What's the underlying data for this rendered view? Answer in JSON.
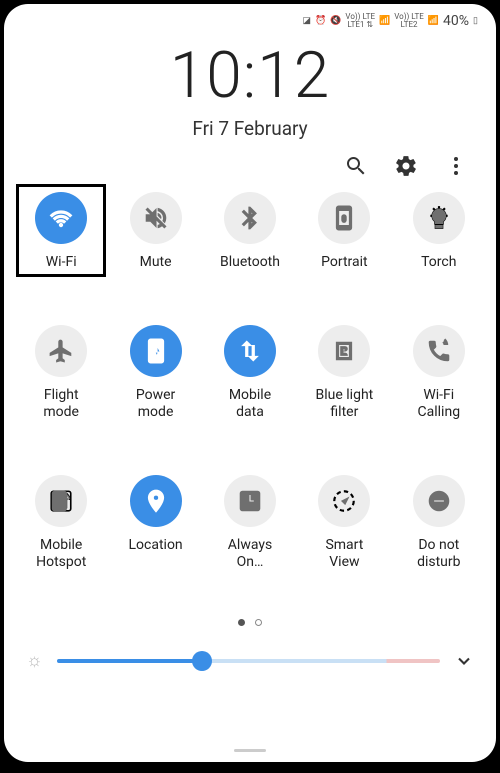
{
  "status": {
    "sim1_top": "Vo)) LTE",
    "sim1_bot": "LTE1 ⇅",
    "sim2_top": "Vo)) LTE",
    "sim2_bot": "LTE2",
    "battery_pct": "40%"
  },
  "clock": "10:12",
  "date": "Fri 7 February",
  "tiles": [
    {
      "id": "wifi",
      "label": "Wi-Fi",
      "on": true,
      "boxed": true
    },
    {
      "id": "mute",
      "label": "Mute",
      "on": false
    },
    {
      "id": "bluetooth",
      "label": "Bluetooth",
      "on": false
    },
    {
      "id": "portrait",
      "label": "Portrait",
      "on": false
    },
    {
      "id": "torch",
      "label": "Torch",
      "on": false
    },
    {
      "id": "flight",
      "label": "Flight\nmode",
      "on": false
    },
    {
      "id": "power",
      "label": "Power\nmode",
      "on": true
    },
    {
      "id": "mobiledata",
      "label": "Mobile\ndata",
      "on": true
    },
    {
      "id": "bluelight",
      "label": "Blue light\nfilter",
      "on": false
    },
    {
      "id": "wificalling",
      "label": "Wi-Fi\nCalling",
      "on": false
    },
    {
      "id": "hotspot",
      "label": "Mobile\nHotspot",
      "on": false
    },
    {
      "id": "location",
      "label": "Location",
      "on": true
    },
    {
      "id": "alwayson",
      "label": "Always\nOn…",
      "on": false
    },
    {
      "id": "smartview",
      "label": "Smart\nView",
      "on": false
    },
    {
      "id": "dnd",
      "label": "Do not\ndisturb",
      "on": false
    }
  ],
  "icons": {
    "wifi": "<path d='M12 20c-.8 0-1.5-.7-1.5-1.5S11.2 17 12 17s1.5.7 1.5 1.5S12.8 20 12 20zm-4.2-4.8c1.1-1.1 2.6-1.7 4.2-1.7s3.1.6 4.2 1.7l-1.4 1.4c-.7-.7-1.7-1.1-2.8-1.1s-2.1.4-2.8 1.1l-1.4-1.4zm-2.8-2.8c1.9-1.9 4.4-2.9 7-2.9s5.1 1 7 2.9l-1.4 1.4c-1.5-1.5-3.5-2.3-5.6-2.3s-4.1.8-5.6 2.3L5 12.4zm-2.8-2.8C5 6.8 8.4 5.5 12 5.5s7 1.3 9.8 4.1l-1.4 1.4C18 8.6 15.1 7.5 12 7.5S6 8.6 3.6 11L2.2 9.6z'/>",
    "mute": "<path d='M3 9v6h4l5 5V4L7 9H3zm13.5 3c0-1.8-1-3.3-2.5-4v1.7l2.4 2.4c.1-.4.1-.7.1-1.1zM19 12c0 .9-.2 1.8-.5 2.6l1.5 1.5c.6-1.2 1-2.6 1-4.1 0-4.3-3-7.9-7-8.8v2.1c2.9.9 5 3.5 5 6.7zM4.3 3L3 4.3 7.7 9H7L3 9v6h4l5 5v-6.7l4.3 4.3c-.7.5-1.4.9-2.3 1.1v2.1c1.4-.3 2.6-.9 3.7-1.8l2 2L21 19.7 4.3 3z'/>",
    "bluetooth": "<path d='M17.7 7.7L12 2h-1v7.6L6.4 5 5 6.4 10.6 12 5 17.6 6.4 19l4.6-4.6V22h1l5.7-5.7L13.4 12l4.3-4.3zM13 5.8l1.9 1.9L13 9.6V5.8zm1.9 10.5L13 18.2v-3.8l1.9 1.9z'/>",
    "portrait": "<path d='M17 1H7C5.9 1 5 1.9 5 3v18c0 1.1.9 2 2 2h10c1.1 0 2-.9 2-2V3c0-1.1-.9-2-2-2zm0 18H7V5h10v14z M12 16c1.1 0 2-.9 2-2v-3c0-1.1-.9-2-2-2s-2 .9-2 2v3c0 1.1.9 2 2 2zm-.7-5c0-.4.3-.7.7-.7s.7.3.7.7v.5h-1.4V11z'/>",
    "torch": "<path d='M9 21h6v-2H9v2zm3-17c-3.3 0-6 2.7-6 6 0 2 1 3.8 2.5 4.8V17h7v-2.2C17 13.8 18 12 18 10c0-3.3-2.7-6-6-6zM6.5 3l1.4 1.4M17.5 3l-1.4 1.4M12 1v2M4 10h2M18 10h2' stroke-width='2' stroke='currentColor' fill='none'/><path d='M9 21h6v-2H9v2zm3-17c-3.3 0-6 2.7-6 6 0 2 1 3.8 2.5 4.8V17h7v-2.2C17 13.8 18 12 18 10c0-3.3-2.7-6-6-6z'/>",
    "flight": "<path d='M21 16v-2l-8-5V3.5C13 2.7 12.3 2 11.5 2S10 2.7 10 3.5V9l-8 5v2l8-2.5V19l-2 1.5V22l3.5-1 3.5 1v-1.5L13 19v-5.5l8 2.5z'/>",
    "power": "<path d='M17 1H7C5.9 1 5 1.9 5 3v18c0 1.1.9 2 2 2h10c1.1 0 2-.9 2-2V3c0-1.1-.9-2-2-2zm-4 16l-2-4h2V7l3 6h-2l-1 4z'/>",
    "mobiledata": "<path d='M9 3L5 7h3v10h2V7h3L9 3zm6 18l4-4h-3V7h-2v10h-3l4 4z'/>",
    "bluelight": "<path d='M5 4h14v16H5V4zm2 2v12h10V6H7zm2 2h4c1.1 0 2 .9 2 2s-.9 2-2 2h-2v2h2c1.1 0 2 .9 2 2H9V8zm2 2v2h2v-2h-2z'/>",
    "wificalling": "<path d='M20 15.5c-1.2 0-2.4-.2-3.6-.6-.4-.1-.8 0-1 .2l-2.2 2.2c-2.8-1.4-5.1-3.8-6.6-6.6l2.2-2.2c.3-.3.4-.7.2-1-.3-1.1-.5-2.3-.5-3.5 0-.6-.4-1-1-1H4c-.6 0-1 .4-1 1 0 9.4 7.6 17 17 17 .6 0 1-.4 1-1v-3.5c0-.6-.4-1-1-1zm-2-9c0-1.2-.5-2.3-1.3-3.1l-.9.9c.6.6.9 1.4.9 2.2M20 6.5c0-2-.8-3.9-2.2-5.3l-.9.9C18 3.2 18.7 4.8 18.7 6.5'/>",
    "hotspot": "<path d='M5 3h14c1.1 0 2 .9 2 2v14c0 1.1-.9 2-2 2H5c-1.1 0-2-.9-2-2V5c0-1.1.9-2 2-2zm2 3v12h10V6H7zm10-1c2 1.5 3 3.5 3 6' stroke='currentColor' stroke-width='1.5' fill='none'/><path d='M6 3h9c1.1 0 2 .9 2 2v14c0 1.1-.9 2-2 2H6c-1.1 0-2-.9-2-2V5c0-1.1.9-2 2-2zm11 3c1.5 1 2.5 2.5 3 4M17 9c.8.5 1.3 1.3 1.5 2'/>",
    "location": "<path d='M12 2C8.1 2 5 5.1 5 9c0 5.2 7 13 7 13s7-7.8 7-13c0-3.9-3.1-7-7-7zm0 9.5c-1.4 0-2.5-1.1-2.5-2.5S10.6 6.5 12 6.5s2.5 1.1 2.5 2.5-1.1 2.5-2.5 2.5z'/>",
    "alwayson": "<path d='M5 3h14c1.1 0 2 .9 2 2v14c0 1.1-.9 2-2 2H5c-1.1 0-2-.9-2-2V5c0-1.1.9-2 2-2zm8 3h-2v7h5v-2h-3V6z'/>",
    "smartview": "<circle cx='12' cy='12' r='9' fill='none' stroke='currentColor' stroke-width='2' stroke-dasharray='4 3'/><path d='M16 9l-6 3 3 3 3-6z'/>",
    "dnd": "<circle cx='12' cy='12' r='9'/><rect x='7' y='11' width='10' height='2' fill='#ededed'/>"
  },
  "brightness": {
    "value": 38
  },
  "colors": {
    "accent": "#3a8ee6",
    "tile_off": "#ededed",
    "icon_off": "#6f6f6f",
    "icon_on": "#ffffff"
  }
}
